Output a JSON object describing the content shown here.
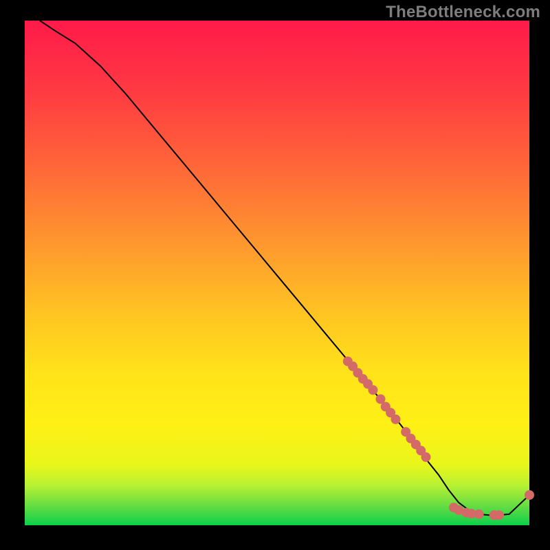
{
  "watermark": "TheBottleneck.com",
  "chart_data": {
    "type": "line",
    "title": "",
    "xlabel": "",
    "ylabel": "",
    "xlim": [
      0,
      100
    ],
    "ylim": [
      0,
      100
    ],
    "gradient_top_color": "#ff1a4a",
    "gradient_bottom_color": "#0ad14a",
    "curve_color": "#000000",
    "marker_color": "#d36a67",
    "x": [
      3,
      6,
      10,
      15,
      20,
      25,
      30,
      35,
      40,
      45,
      50,
      55,
      60,
      65,
      68,
      70,
      72,
      74,
      76,
      78,
      80,
      82,
      84,
      86,
      88,
      90,
      92,
      94,
      96,
      100
    ],
    "y": [
      100,
      98,
      95.5,
      91,
      85.5,
      79.5,
      73.5,
      67.5,
      61.5,
      55.5,
      49.5,
      43.5,
      37.5,
      31.5,
      28,
      25.5,
      23,
      20.5,
      18,
      15.5,
      12.5,
      10,
      7,
      4.5,
      3,
      2.2,
      2,
      2,
      2.2,
      6
    ],
    "marker_clusters": [
      {
        "x": 64,
        "y": 32.5
      },
      {
        "x": 65,
        "y": 31.5
      },
      {
        "x": 66,
        "y": 30.2
      },
      {
        "x": 67,
        "y": 29
      },
      {
        "x": 68,
        "y": 28
      },
      {
        "x": 69,
        "y": 26.8
      },
      {
        "x": 70.5,
        "y": 25
      },
      {
        "x": 71.5,
        "y": 23.5
      },
      {
        "x": 72.5,
        "y": 22.3
      },
      {
        "x": 73.5,
        "y": 21
      },
      {
        "x": 75.5,
        "y": 18.5
      },
      {
        "x": 76.5,
        "y": 17.2
      },
      {
        "x": 77.5,
        "y": 16
      },
      {
        "x": 78.5,
        "y": 14.8
      },
      {
        "x": 79.5,
        "y": 13.5
      },
      {
        "x": 85,
        "y": 3.5
      },
      {
        "x": 86,
        "y": 3
      },
      {
        "x": 87.5,
        "y": 2.5
      },
      {
        "x": 88.5,
        "y": 2.3
      },
      {
        "x": 90,
        "y": 2.2
      },
      {
        "x": 93,
        "y": 2
      },
      {
        "x": 94,
        "y": 2
      },
      {
        "x": 100,
        "y": 6
      }
    ]
  }
}
